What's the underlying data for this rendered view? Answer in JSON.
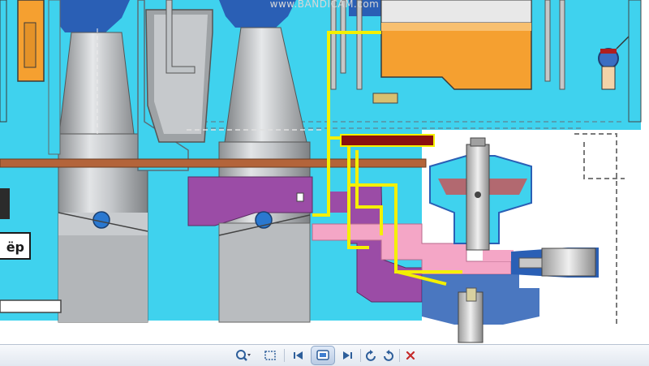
{
  "watermark": "www.BANDICAM.com",
  "side_label": "ёр",
  "colors": {
    "cyan": "#3fd2ee",
    "dark_blue": "#2a5fb5",
    "orange": "#f5a030",
    "yellow": "#f4f000",
    "purple": "#9b4ca6",
    "pink": "#f4a6c6",
    "gray": "#b9bcbf",
    "brown": "#b3643a",
    "dark_red": "#8a1010"
  },
  "toolbar": {
    "icons": [
      "zoom-icon",
      "fit-window-icon",
      "previous-icon",
      "slideshow-icon",
      "next-icon",
      "rotate-left-icon",
      "rotate-right-icon",
      "delete-icon"
    ]
  }
}
